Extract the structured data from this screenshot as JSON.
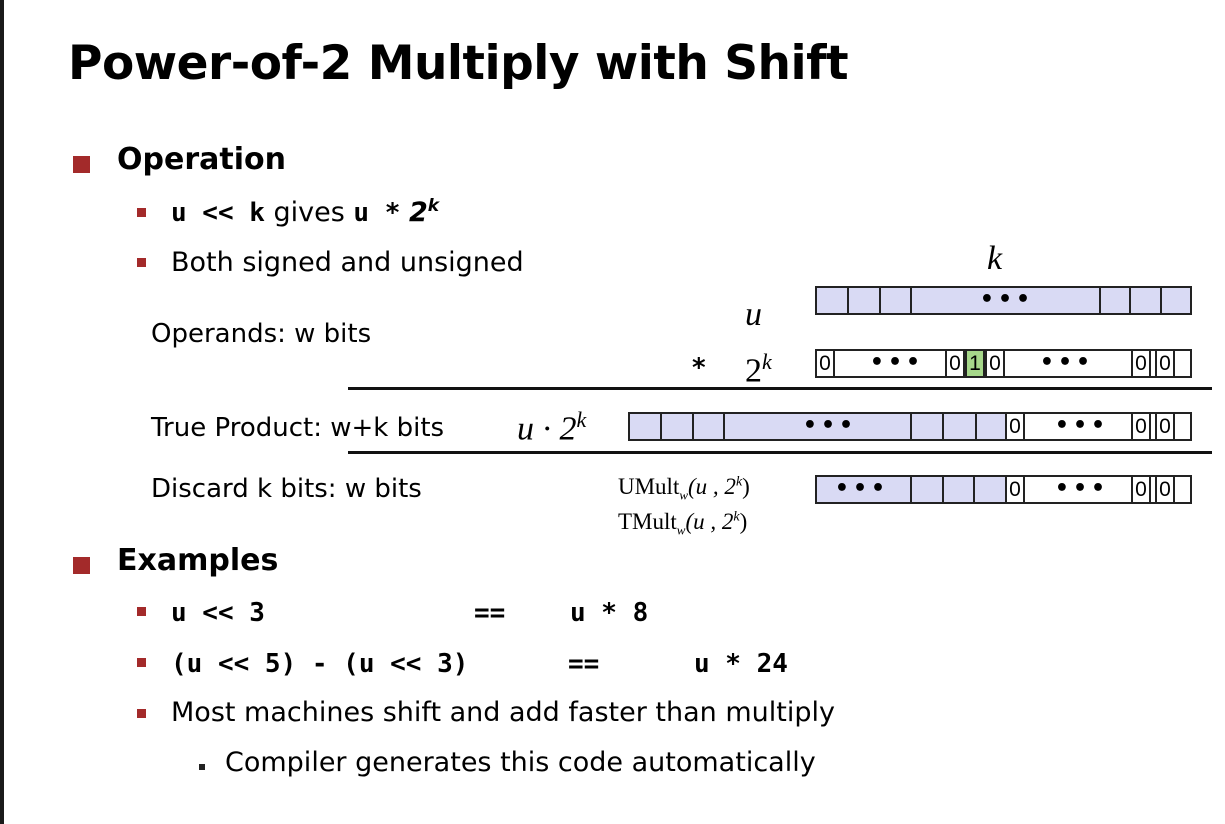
{
  "title": "Power-of-2 Multiply with Shift",
  "operation": {
    "heading": "Operation",
    "bullet1": {
      "code1": "u << k",
      "text": "gives",
      "code2": "u *",
      "base": "2",
      "exp": "k"
    },
    "bullet2": "Both signed and unsigned"
  },
  "diagram": {
    "k_label": "k",
    "u_label": "u",
    "times": "*",
    "two": "2",
    "two_exp": "k",
    "operands_label": "Operands: w bits",
    "true_product_label": "True Product: w+k  bits",
    "product_expr": "u · 2",
    "product_exp": "k",
    "discard_label": "Discard k  bits: w bits",
    "umult": "UMult",
    "tmult": "TMult",
    "sub_w": "w",
    "mult_args": "(u , 2",
    "mult_exp": "k",
    "mult_close": ")",
    "bit0": "0",
    "bit1": "1",
    "dots": "•••",
    "fill_color": "#d9daf4",
    "highlight_color": "#a6d88a"
  },
  "examples": {
    "heading": "Examples",
    "ex1_left": "u << 3",
    "ex1_eq": "==",
    "ex1_right": "u * 8",
    "ex2_left": "(u << 5) - (u << 3)",
    "ex2_eq": "==",
    "ex2_right": "u * 24",
    "bullet3": "Most machines shift and add faster than multiply",
    "sub_bullet": "Compiler generates this code automatically"
  },
  "bullet_color": "#a32a2a"
}
